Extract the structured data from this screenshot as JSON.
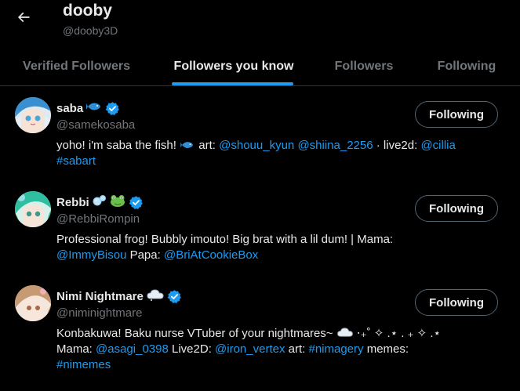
{
  "header": {
    "title": "dooby",
    "handle": "@dooby3D"
  },
  "tabs": [
    {
      "label": "Verified Followers",
      "active": false
    },
    {
      "label": "Followers you know",
      "active": true
    },
    {
      "label": "Followers",
      "active": false
    },
    {
      "label": "Following",
      "active": false
    }
  ],
  "users": [
    {
      "name": "saba",
      "name_emoji": "fish-icon",
      "handle": "@samekosaba",
      "follow_label": "Following",
      "bio": {
        "t1": "yoho! i'm saba the fish! ",
        "t2": " art: ",
        "l1": "@shouu_kyun",
        "t3": " ",
        "l2": "@shiina_2256",
        "t4": "  ·  live2d: ",
        "l3": "@cillia",
        "l4": "#sabart"
      }
    },
    {
      "name": "Rebbi",
      "name_emoji": "bubbles-frog-icon",
      "handle": "@RebbiRompin",
      "follow_label": "Following",
      "bio": {
        "t1": "Professional frog! Bubbly imouto! Big brat with a lil dum! | Mama:",
        "l1": "@ImmyBisou",
        "t2": " Papa: ",
        "l2": "@BriAtCookieBox"
      }
    },
    {
      "name": "Nimi Nightmare",
      "name_emoji": "cloud-icon",
      "handle": "@niminightmare",
      "follow_label": "Following",
      "bio": {
        "t1": "Konbakuwa! Baku nurse VTuber of your nightmares~ ",
        "t1b": " ⋅₊˚ ✧ .⋆ . ₊ ✧ .⋆",
        "t2": "Mama: ",
        "l1": "@asagi_0398",
        "t3": " Live2D: ",
        "l2": "@iron_vertex",
        "t4": " art: ",
        "l3": "#nimagery",
        "t5": " memes:",
        "l4": "#nimemes"
      }
    }
  ],
  "colors": {
    "accent": "#1d9bf0",
    "text": "#e7e9ea",
    "muted": "#71767b",
    "background": "#000000"
  }
}
